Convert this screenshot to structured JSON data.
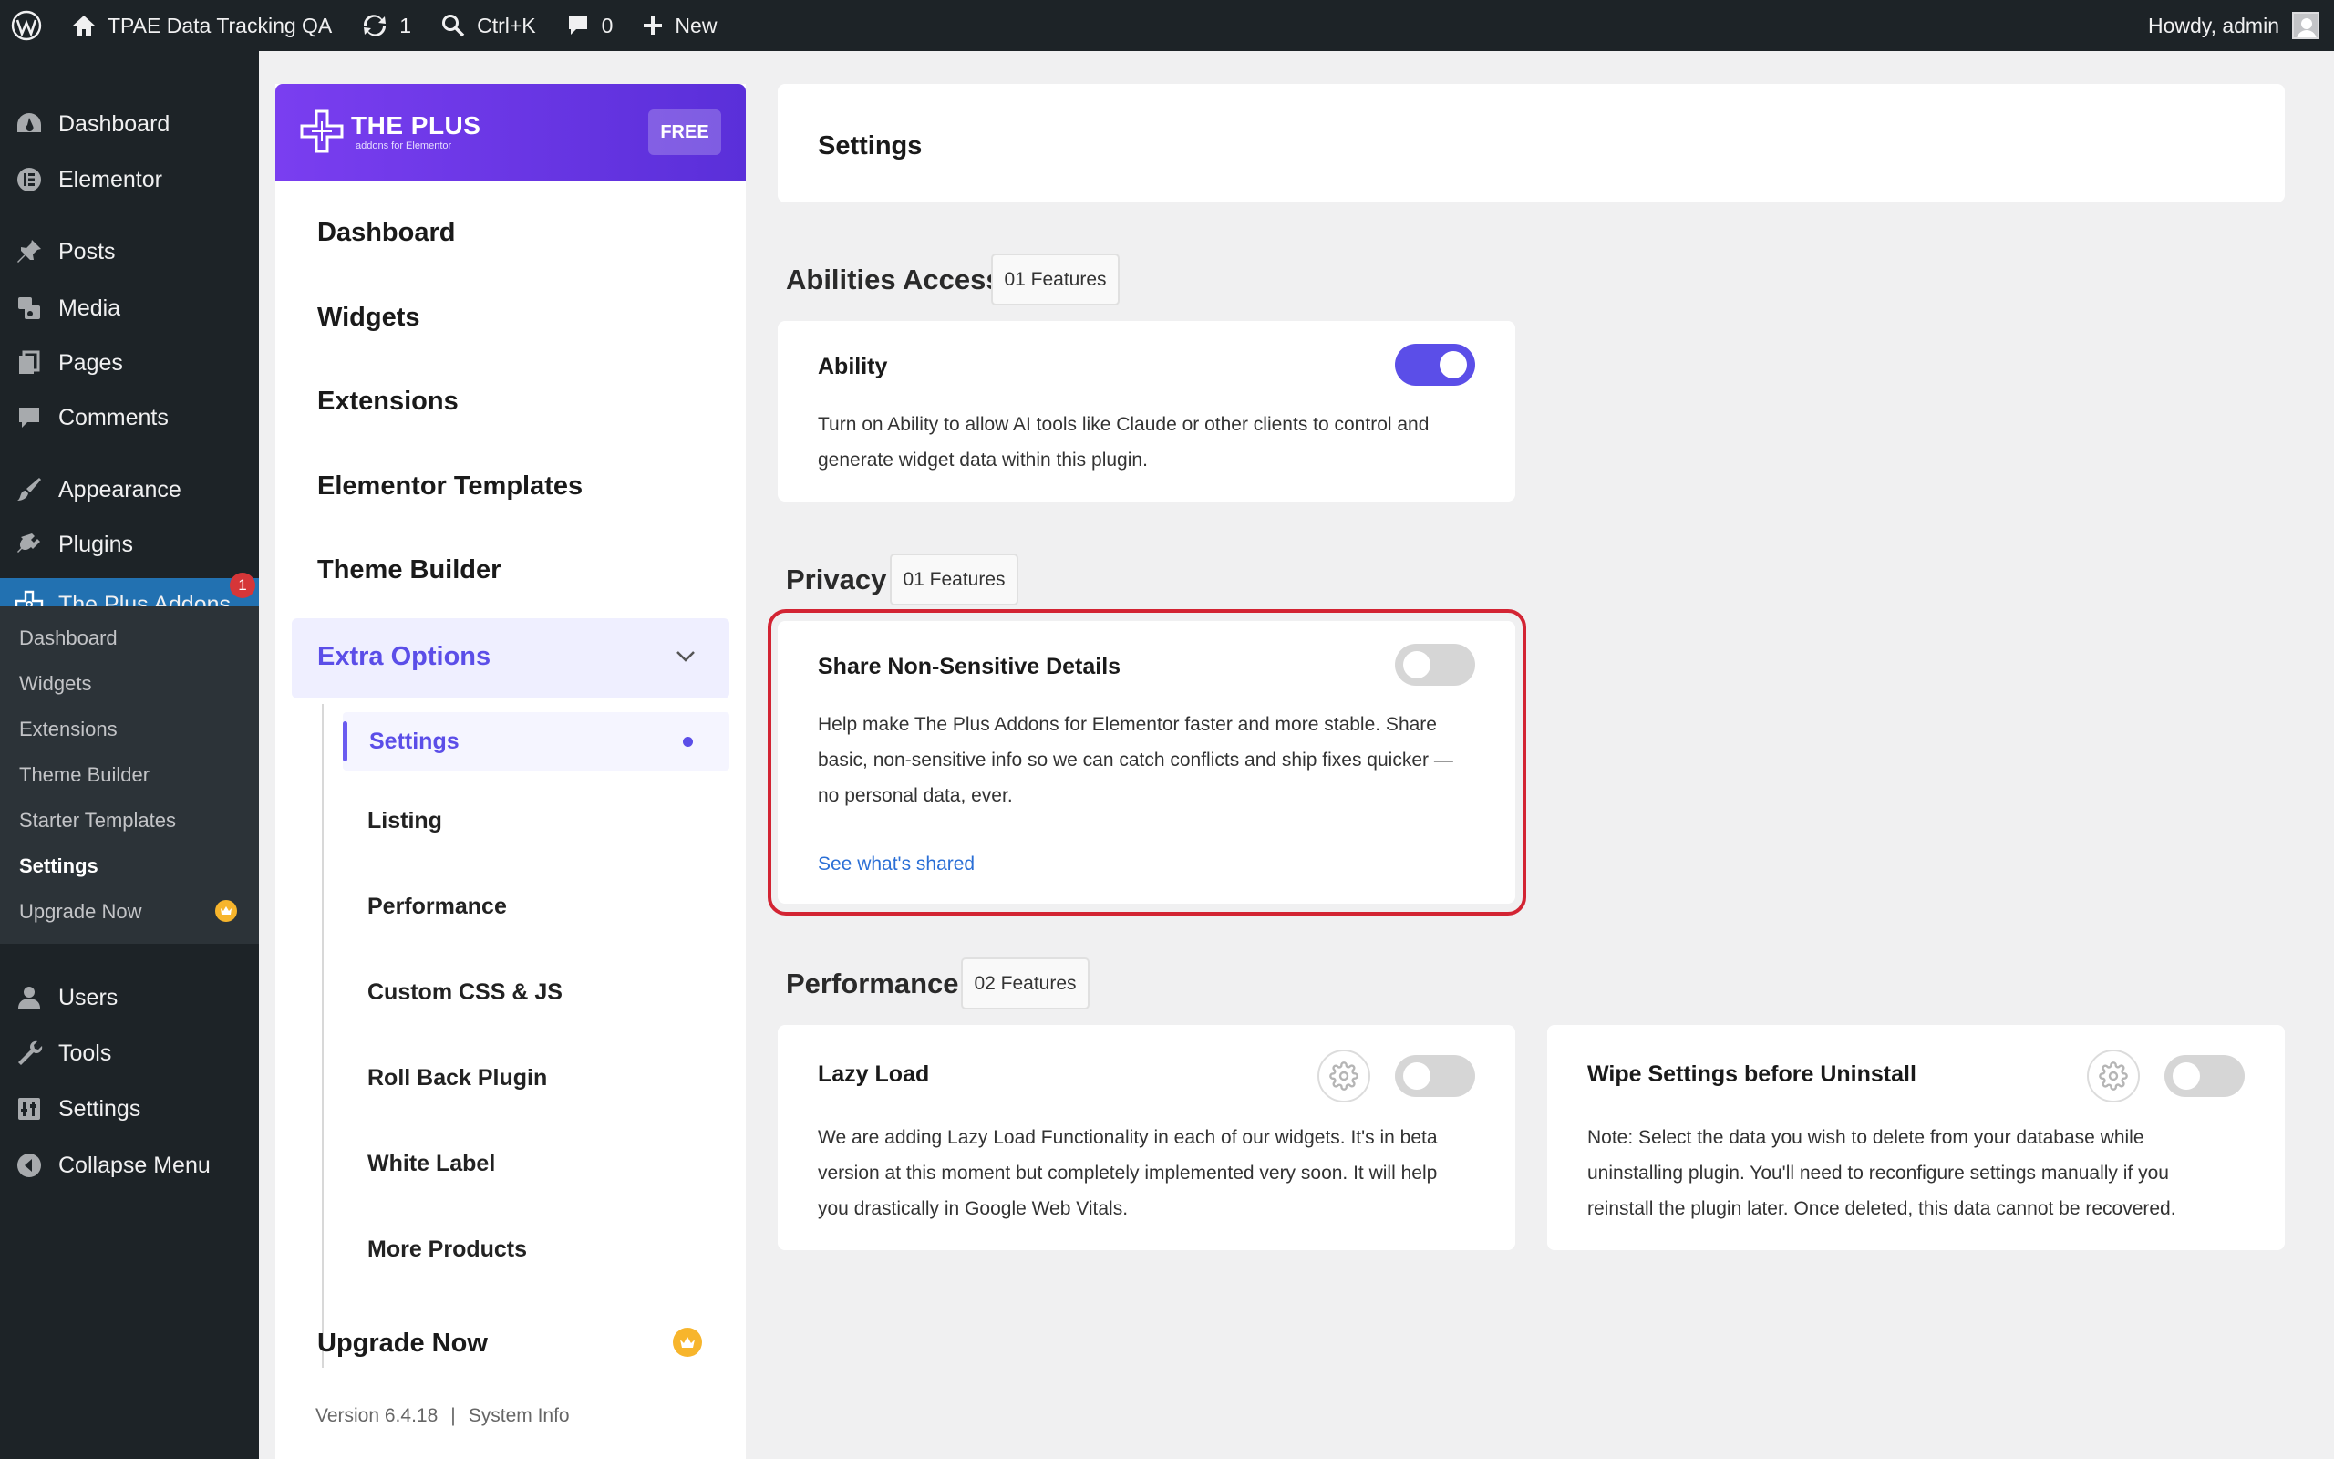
{
  "admin_bar": {
    "site_name": "TPAE Data Tracking QA",
    "updates_count": "1",
    "search_shortcut": "Ctrl+K",
    "comments_count": "0",
    "new_label": "New",
    "howdy": "Howdy, admin"
  },
  "wp_menu": {
    "dashboard": "Dashboard",
    "elementor": "Elementor",
    "posts": "Posts",
    "media": "Media",
    "pages": "Pages",
    "comments": "Comments",
    "appearance": "Appearance",
    "plugins": "Plugins",
    "plus_addons": "The Plus Addons",
    "plus_addons_badge": "1",
    "users": "Users",
    "tools": "Tools",
    "settings": "Settings",
    "collapse": "Collapse Menu"
  },
  "wp_submenu": {
    "items": [
      "Dashboard",
      "Widgets",
      "Extensions",
      "Theme Builder",
      "Starter Templates",
      "Settings",
      "Upgrade Now"
    ],
    "active": "Settings"
  },
  "plugin_nav": {
    "brand": "THE PLUS",
    "tagline": "addons for Elementor",
    "free_badge": "FREE",
    "items": [
      "Dashboard",
      "Widgets",
      "Extensions",
      "Elementor Templates",
      "Theme Builder"
    ],
    "extra_options": "Extra Options",
    "sub_items": [
      "Settings",
      "Listing",
      "Performance",
      "Custom CSS & JS",
      "Roll Back Plugin",
      "White Label",
      "More Products"
    ],
    "upgrade": "Upgrade Now",
    "version": "Version 6.4.18",
    "system_info": "System Info"
  },
  "page": {
    "title": "Settings"
  },
  "sections": {
    "abilities": {
      "title": "Abilities Access",
      "badge": "01 Features",
      "card_title": "Ability",
      "card_desc_1": "Turn on Ability to allow AI tools like Claude or other clients to control and",
      "card_desc_2": "generate widget data within this plugin.",
      "enabled": true
    },
    "privacy": {
      "title": "Privacy",
      "badge": "01 Features",
      "card_title": "Share Non-Sensitive Details",
      "card_desc_1": "Help make The Plus Addons for Elementor faster and more stable. Share",
      "card_desc_2": "basic, non-sensitive info so we can catch conflicts and ship fixes quicker —",
      "card_desc_3": "no personal data, ever.",
      "link": "See what's shared",
      "enabled": false
    },
    "performance": {
      "title": "Performance",
      "badge": "02 Features",
      "lazy_title": "Lazy Load",
      "lazy_desc_1": "We are adding Lazy Load Functionality in each of our widgets. It's in beta",
      "lazy_desc_2": "version at this moment but completely implemented very soon. It will help",
      "lazy_desc_3": "you drastically in Google Web Vitals.",
      "lazy_enabled": false,
      "wipe_title": "Wipe Settings before Uninstall",
      "wipe_desc_1": "Note: Select the data you wish to delete from your database while",
      "wipe_desc_2": "uninstalling plugin. You'll need to reconfigure settings manually if you",
      "wipe_desc_3": "reinstall the plugin later. Once deleted, this data cannot be recovered.",
      "wipe_enabled": false
    }
  },
  "colors": {
    "accent": "#5b4ee8",
    "highlight": "#d32433",
    "wp_admin_dark": "#1d2327",
    "wp_current": "#2271b1"
  }
}
